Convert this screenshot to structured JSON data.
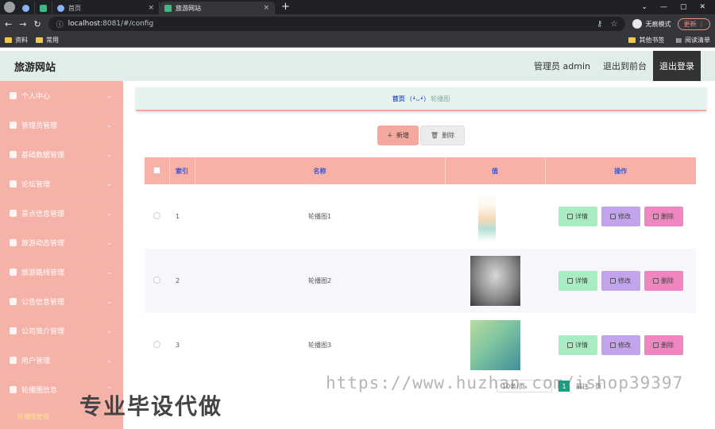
{
  "browser": {
    "tabs": [
      {
        "label": ""
      },
      {
        "label": ""
      },
      {
        "label": "首页"
      },
      {
        "label": "旅游网站"
      }
    ],
    "url_host": "localhost",
    "url_rest": ":8081/#/config",
    "incognito_label": "无痕模式",
    "update_label": "更新",
    "bookmarks": [
      "资料",
      "常用"
    ],
    "bookmarks_right": [
      "其他书签",
      "阅读清单"
    ],
    "new_tab": "+",
    "close_x": "×"
  },
  "header": {
    "title": "旅游网站",
    "user_label": "管理员 admin",
    "back_to_front": "退出到前台",
    "logout": "退出登录"
  },
  "sidebar": {
    "items": [
      {
        "label": "个人中心",
        "icon": "user-icon"
      },
      {
        "label": "管理员管理",
        "icon": "send-icon"
      },
      {
        "label": "基础数据管理",
        "icon": "flag-icon"
      },
      {
        "label": "论坛管理",
        "icon": "copy-icon"
      },
      {
        "label": "景点信息管理",
        "icon": "crop-icon"
      },
      {
        "label": "旅游动态管理",
        "icon": "thumb-down-icon"
      },
      {
        "label": "旅游路线管理",
        "icon": "monitor-icon"
      },
      {
        "label": "公告信息管理",
        "icon": "bank-icon"
      },
      {
        "label": "公司简介管理",
        "icon": "list-icon"
      },
      {
        "label": "用户管理",
        "icon": "trash-icon"
      },
      {
        "label": "轮播图信息",
        "icon": "camera-icon"
      }
    ],
    "sub_item": "轮播图管理"
  },
  "breadcrumb": {
    "home": "首页",
    "face": "(•̀ᴗ•́)",
    "current": "轮播图"
  },
  "toolbar": {
    "add_label": "新增",
    "delete_label": "删除"
  },
  "table": {
    "headers": [
      "索引",
      "名称",
      "值",
      "操作"
    ],
    "rows": [
      {
        "index": "1",
        "name": "轮播图1"
      },
      {
        "index": "2",
        "name": "轮播图2"
      },
      {
        "index": "3",
        "name": "轮播图3"
      }
    ],
    "op_detail": "详情",
    "op_edit": "修改",
    "op_delete": "删除"
  },
  "pager": {
    "page_size": "10条/页",
    "current_page": "1",
    "goto_label": "前往",
    "page_unit": "页"
  },
  "watermark": {
    "url": "https://www.huzhan.com/ishop39397",
    "text": "专业毕设代做"
  }
}
